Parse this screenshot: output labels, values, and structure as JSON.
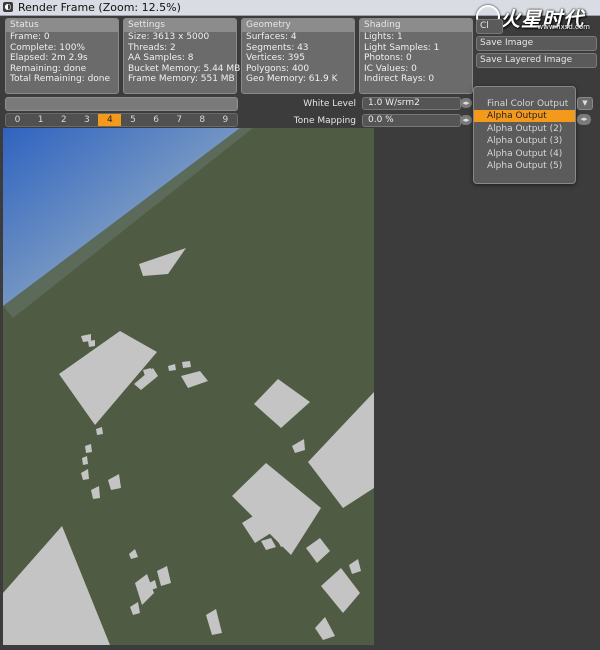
{
  "window": {
    "title": "Render Frame (Zoom: 12.5%)",
    "watermark_text": "火星时代",
    "watermark_url": "www.hxsd.com"
  },
  "panels": {
    "status": {
      "header": "Status",
      "lines": [
        "Frame: 0",
        "Complete: 100%",
        "Elapsed: 2m 2.9s",
        "Remaining: done",
        "Total Remaining: done"
      ]
    },
    "settings": {
      "header": "Settings",
      "lines": [
        "Size: 3613 x 5000",
        "Threads: 2",
        "AA Samples: 8",
        "Bucket Memory: 5.44 MB",
        "Frame Memory: 551 MB"
      ]
    },
    "geometry": {
      "header": "Geometry",
      "lines": [
        "Surfaces: 4",
        "Segments: 43",
        "Vertices: 395",
        "Polygons: 400",
        "Geo Memory: 61.9 K"
      ]
    },
    "shading": {
      "header": "Shading",
      "lines": [
        "Lights: 1",
        "Light Samples: 1",
        "Photons: 0",
        "IC Values: 0",
        "Indirect Rays: 0"
      ]
    }
  },
  "buttons": {
    "clear_partial": "Cl",
    "save_image": "Save Image",
    "save_layered": "Save Layered Image"
  },
  "progress": {
    "fraction": 1.0
  },
  "frames": {
    "items": [
      "0",
      "1",
      "2",
      "3",
      "4",
      "5",
      "6",
      "7",
      "8",
      "9"
    ],
    "active_index": 4
  },
  "controls": {
    "white_level_label": "White Level",
    "white_level_value": "1.0 W/srm2",
    "tone_mapping_label": "Tone Mapping",
    "tone_mapping_value": "0.0 %"
  },
  "output_menu": {
    "selected": "Alpha Output",
    "options": [
      "Final Color Output",
      "Alpha Output",
      "Alpha Output (2)",
      "Alpha Output (3)",
      "Alpha Output (4)",
      "Alpha Output (5)"
    ]
  },
  "colors": {
    "accent": "#f39a1d",
    "sky_top": "#3b6fc6",
    "ground": "#4f5b43",
    "shapes": "#c4c4c4",
    "background": "#3c3c3c"
  }
}
